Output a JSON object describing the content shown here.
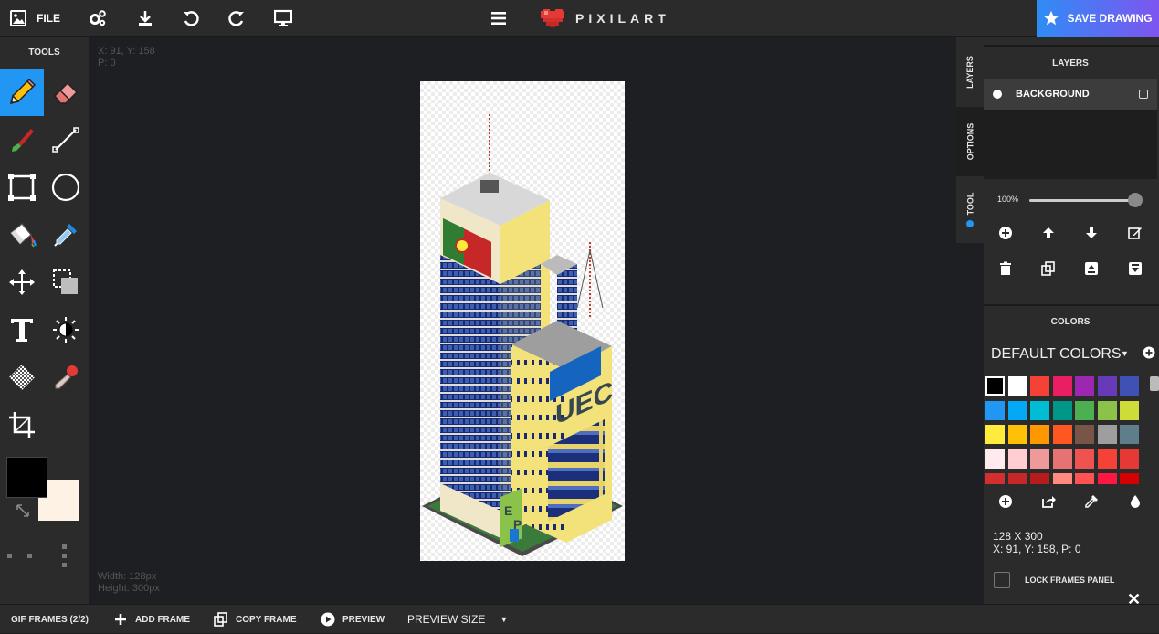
{
  "topbar": {
    "file_label": "FILE",
    "logo_text": "PIXILART",
    "save_label": "SAVE DRAWING",
    "accent_gradient": [
      "#2f8cf5",
      "#7e55f0"
    ],
    "icons": [
      "image-icon",
      "settings-icon",
      "download-icon",
      "undo-icon",
      "redo-icon",
      "display-icon",
      "menu-icon",
      "heart-logo-icon",
      "star-icon"
    ]
  },
  "tools": {
    "title": "TOOLS",
    "items": [
      "pencil",
      "eraser",
      "paint-brush",
      "line",
      "rectangle",
      "ellipse",
      "bucket-fill",
      "eyedropper",
      "move",
      "select",
      "text",
      "lighten-darken",
      "dither",
      "stamp",
      "crop"
    ],
    "active": "pencil",
    "primary_color": "#000000",
    "secondary_color": "#fdf2e3"
  },
  "canvas": {
    "coords": "X: 91, Y: 158",
    "pixel": "P: 0",
    "width_label": "Width: 128px",
    "height_label": "Height: 300px"
  },
  "side_tabs": {
    "layers": "LAYERS",
    "options": "OPTIONS",
    "tool": "TOOL"
  },
  "layers": {
    "title": "LAYERS",
    "items": [
      {
        "name": "BACKGROUND"
      }
    ],
    "opacity_label": "100%",
    "opacity_value": 100
  },
  "colors": {
    "title": "COLORS",
    "palette_name": "DEFAULT COLORS",
    "swatches": [
      "#000000",
      "#ffffff",
      "#f44336",
      "#e91e63",
      "#9c27b0",
      "#673ab7",
      "#3f51b5",
      "#2196f3",
      "#03a9f4",
      "#00bcd4",
      "#009688",
      "#4caf50",
      "#8bc34a",
      "#cddc39",
      "#ffeb3b",
      "#ffc107",
      "#ff9800",
      "#ff5722",
      "#795548",
      "#9e9e9e",
      "#607d8b",
      "#ffebee",
      "#ffcdd2",
      "#ef9a9a",
      "#e57373",
      "#ef5350",
      "#f44336",
      "#e53935",
      "#d32f2f",
      "#c62828",
      "#b71c1c",
      "#ff8a80",
      "#ff5252",
      "#ff1744",
      "#d50000"
    ]
  },
  "info": {
    "size": "128 X 300",
    "position": "X: 91, Y: 158, P: 0",
    "lock_label": "LOCK FRAMES PANEL"
  },
  "bottombar": {
    "frames_label": "GIF FRAMES (2/2)",
    "add_frame": "ADD FRAME",
    "copy_frame": "COPY FRAME",
    "preview": "PREVIEW",
    "preview_size": "PREVIEW SIZE"
  }
}
